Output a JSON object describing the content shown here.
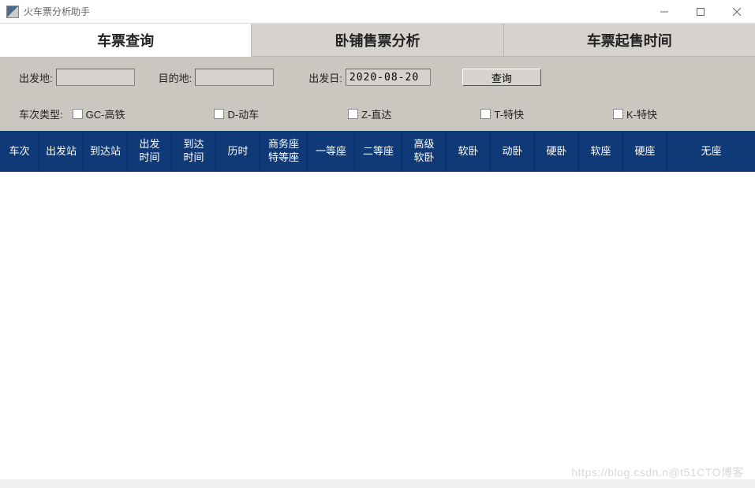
{
  "window": {
    "title": "火车票分析助手"
  },
  "tabs": [
    {
      "label": "车票查询",
      "active": true
    },
    {
      "label": "卧铺售票分析",
      "active": false
    },
    {
      "label": "车票起售时间",
      "active": false
    }
  ],
  "search": {
    "departure_label": "出发地:",
    "departure_value": "",
    "destination_label": "目的地:",
    "destination_value": "",
    "date_label": "出发日:",
    "date_value": "2020-08-20",
    "button_label": "查询"
  },
  "train_type": {
    "label": "车次类型:",
    "options": [
      {
        "label": "GC-高铁",
        "checked": false
      },
      {
        "label": "D-动车",
        "checked": false
      },
      {
        "label": "Z-直达",
        "checked": false
      },
      {
        "label": "T-特快",
        "checked": false
      },
      {
        "label": "K-特快",
        "checked": false
      }
    ]
  },
  "columns": [
    "车次",
    "出发站",
    "到达站",
    "出发\n时间",
    "到达\n时间",
    "历时",
    "商务座\n特等座",
    "一等座",
    "二等座",
    "高级\n软卧",
    "软卧",
    "动卧",
    "硬卧",
    "软座",
    "硬座",
    "无座"
  ],
  "watermark": "https://blog.csdn.n@t51CTO博客"
}
